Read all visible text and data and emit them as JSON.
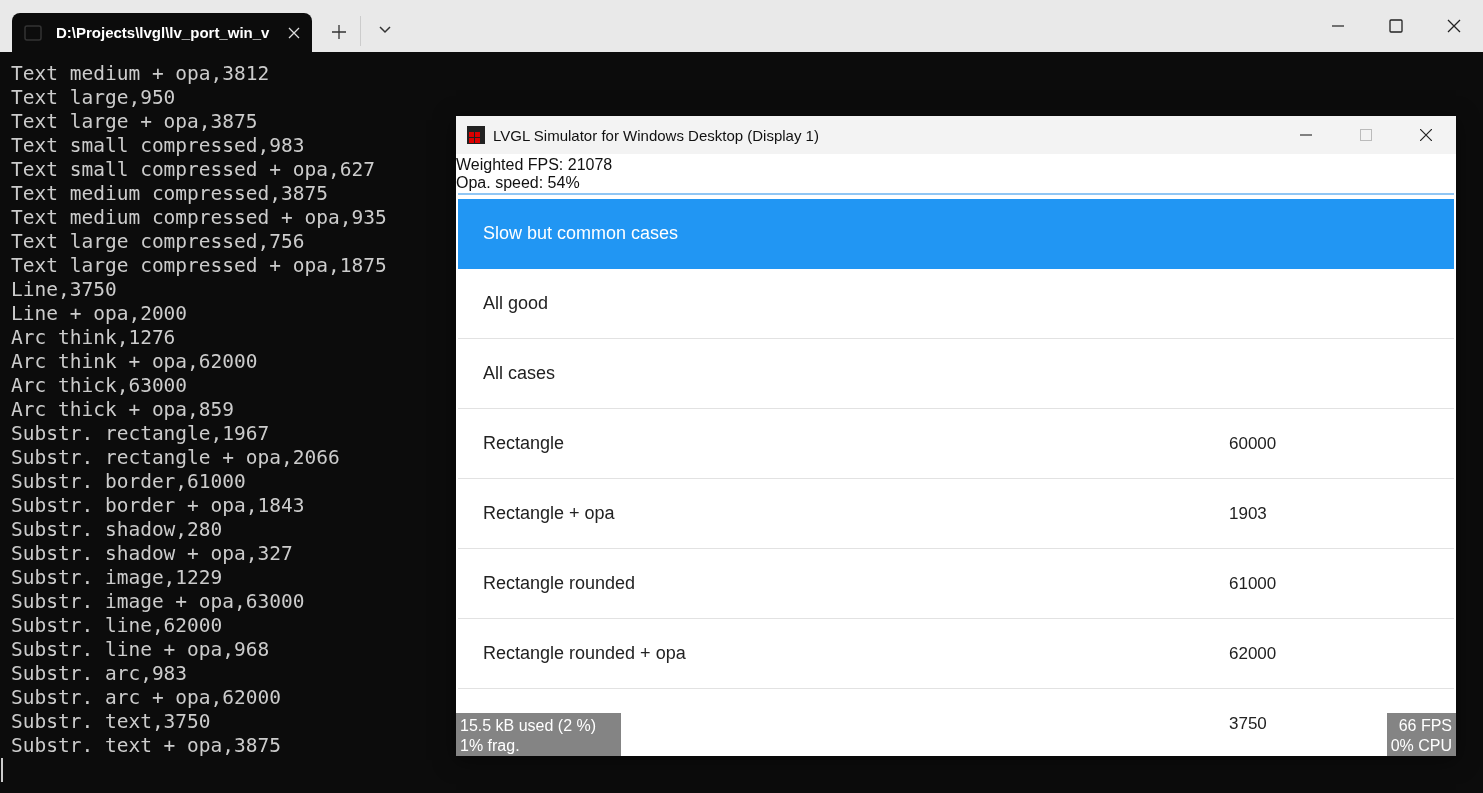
{
  "terminal": {
    "tab_title": "D:\\Projects\\lvgl\\lv_port_win_v",
    "lines": [
      "Text medium + opa,3812",
      "Text large,950",
      "Text large + opa,3875",
      "Text small compressed,983",
      "Text small compressed + opa,627",
      "Text medium compressed,3875",
      "Text medium compressed + opa,935",
      "Text large compressed,756",
      "Text large compressed + opa,1875",
      "Line,3750",
      "Line + opa,2000",
      "Arc think,1276",
      "Arc think + opa,62000",
      "Arc thick,63000",
      "Arc thick + opa,859",
      "Substr. rectangle,1967",
      "Substr. rectangle + opa,2066",
      "Substr. border,61000",
      "Substr. border + opa,1843",
      "Substr. shadow,280",
      "Substr. shadow + opa,327",
      "Substr. image,1229",
      "Substr. image + opa,63000",
      "Substr. line,62000",
      "Substr. line + opa,968",
      "Substr. arc,983",
      "Substr. arc + opa,62000",
      "Substr. text,3750",
      "Substr. text + opa,3875"
    ]
  },
  "simulator": {
    "title": "LVGL Simulator for Windows Desktop (Display 1)",
    "stats": [
      "Weighted FPS: 21078",
      "Opa. speed: 54%"
    ],
    "rows": [
      {
        "label": "Slow but common cases",
        "selected": true
      },
      {
        "label": "All good",
        "selected": false
      },
      {
        "label": "All cases",
        "selected": false
      },
      {
        "label": "Rectangle",
        "value": "60000",
        "selected": false
      },
      {
        "label": "Rectangle + opa",
        "value": "1903",
        "selected": false
      },
      {
        "label": "Rectangle rounded",
        "value": "61000",
        "selected": false
      },
      {
        "label": "Rectangle rounded + opa",
        "value": "62000",
        "selected": false
      },
      {
        "value": "3750",
        "selected": false
      }
    ],
    "memory_monitor": [
      "15.5 kB used (2 %)",
      "1% frag."
    ],
    "perf_monitor": [
      "66 FPS",
      "0% CPU"
    ]
  }
}
